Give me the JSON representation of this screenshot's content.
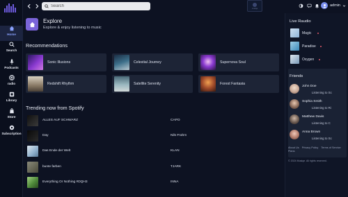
{
  "sidebar": {
    "items": [
      {
        "label": "Home",
        "icon": "home-icon",
        "active": true
      },
      {
        "label": "Search",
        "icon": "search-icon",
        "active": false
      },
      {
        "label": "Podcasts",
        "icon": "microphone-icon",
        "active": false
      },
      {
        "label": "radio",
        "icon": "radio-icon",
        "active": false
      },
      {
        "label": "Library",
        "icon": "library-icon",
        "active": false
      },
      {
        "label": "Store",
        "icon": "store-icon",
        "active": false
      },
      {
        "label": "Subscription",
        "icon": "subscription-icon",
        "active": false
      }
    ]
  },
  "topbar": {
    "search_placeholder": "Search",
    "username": "admin",
    "center_thumb_label": "musiqe"
  },
  "explore": {
    "title": "Explore",
    "subtitle": "Explore & enjoy listening to music"
  },
  "recommendations": {
    "title": "Recommendations",
    "items": [
      {
        "label": "Sonic Illusions",
        "color": "#6a3aa8"
      },
      {
        "label": "Celestial Journey",
        "color": "#3d5f78"
      },
      {
        "label": "Supernova Soul",
        "color": "#7b3c9e"
      },
      {
        "label": "Redshift Rhythm",
        "color": "#8a7a66"
      },
      {
        "label": "Satellite Serenity",
        "color": "#6a8a96"
      },
      {
        "label": "Forest Fantasia",
        "color": "#a04a2a"
      }
    ]
  },
  "trending": {
    "title": "Trending now from Spotify",
    "tracks": [
      {
        "title": "ALLES AUF SCHWARZ",
        "artist": "CAPO",
        "color": "#1a1a1a"
      },
      {
        "title": "Day",
        "artist": "Nils Frahm",
        "color": "#2a2a2a"
      },
      {
        "title": "Das Ende der Welt",
        "artist": "KLAN",
        "color": "#8fb0cc"
      },
      {
        "title": "bunte farben",
        "artist": "TJARK",
        "color": "#6a6a5a"
      },
      {
        "title": "Everything Or Nothing #DQH3",
        "artist": "INNA",
        "color": "#4f8a3a"
      }
    ]
  },
  "live_radio": {
    "title": "Live Raudio",
    "stations": [
      {
        "name": "Magic",
        "color": "#8fb4d8"
      },
      {
        "name": "Paradise",
        "color": "#5aa0c8"
      },
      {
        "name": "Oxygen",
        "color": "#9ab8d0"
      }
    ]
  },
  "friends": {
    "title": "Friends",
    "list": [
      {
        "name": "John Doe",
        "status": "Listening to Sc",
        "color": "#c8a896"
      },
      {
        "name": "Sophia Smith",
        "status": "Listening to Ri",
        "color": "#8a6a5a"
      },
      {
        "name": "Matthew Davis",
        "status": "Listening to C",
        "color": "#6a5a50"
      },
      {
        "name": "Anna Brown",
        "status": "Listening to Sc",
        "color": "#b07a6a"
      }
    ]
  },
  "footer": {
    "links": [
      "About Us",
      "Privacy Policy",
      "Terms of Service",
      "Plans"
    ],
    "copyright": "© 2024 Musiqe. All rights reserved."
  }
}
